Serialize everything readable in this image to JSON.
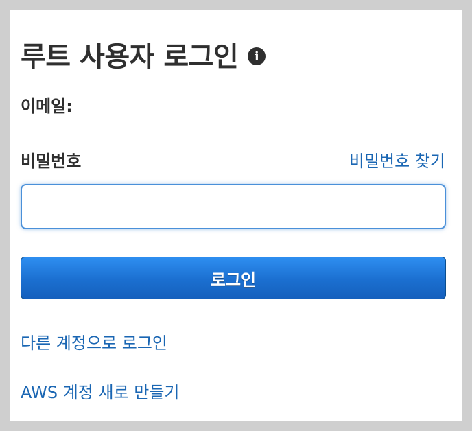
{
  "header": {
    "title": "루트 사용자 로그인",
    "info_icon": "info-icon",
    "info_glyph": "i"
  },
  "form": {
    "email_label": "이메일:",
    "password_label": "비밀번호",
    "forgot_password_link": "비밀번호 찾기",
    "password_value": "",
    "login_button_label": "로그인"
  },
  "links": {
    "other_account": "다른 계정으로 로그인",
    "create_account": "AWS 계정 새로 만들기"
  },
  "colors": {
    "page_background": "#cfcfcf",
    "card_background": "#ffffff",
    "text": "#2f2f2f",
    "link": "#1a66b3",
    "button_primary": "#1b6fd0",
    "input_focus_border": "#4a90d9"
  }
}
